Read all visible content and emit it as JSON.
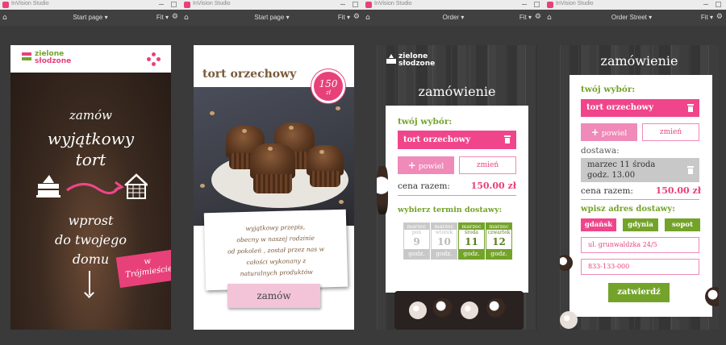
{
  "app_name": "InVision Studio",
  "panels": [
    {
      "page": "Start page",
      "zoom": "Fit"
    },
    {
      "page": "Start page",
      "zoom": "Fit"
    },
    {
      "page": "Order",
      "zoom": "Fit"
    },
    {
      "page": "Order Street",
      "zoom": "Fit"
    }
  ],
  "brand": {
    "line1": "zielone",
    "line2": "słodzone"
  },
  "icons": {
    "home": "⌂",
    "gear": "⚙",
    "caret": "▾"
  },
  "colors": {
    "pink": "#e8417a",
    "green": "#74a32a",
    "light_pink": "#f3c4d8"
  },
  "screen1": {
    "line1": "zamów",
    "line2": "wyjątkowy",
    "line3": "tort",
    "line4": "wprost",
    "line5": "do twojego",
    "line6": "domu",
    "tag_line1": "w",
    "tag_line2": "Trójmieście"
  },
  "screen2": {
    "title": "tort orzechowy",
    "price": "150",
    "currency": "zł",
    "description": [
      "wyjątkowy przepis,",
      "obecny w naszej rodzinie",
      "od pokoleń , został przez nas w",
      "całości wykonany z",
      "naturalnych produktów"
    ],
    "order_button": "zamów"
  },
  "screen3": {
    "heading": "zamówienie",
    "choice_label": "twój wybór:",
    "item": "tort orzechowy",
    "repeat_button": "powiel",
    "change_button": "zmień",
    "total_label": "cena razem:",
    "total_value": "150.00 zł",
    "delivery_label": "wybierz termin dostawy:",
    "days": [
      {
        "month": "marzec",
        "weekday": "pon",
        "day": "9",
        "label": "godz.",
        "available": false
      },
      {
        "month": "marzec",
        "weekday": "wtorek",
        "day": "10",
        "label": "godz.",
        "available": false
      },
      {
        "month": "marzec",
        "weekday": "środa",
        "day": "11",
        "label": "godz.",
        "available": true
      },
      {
        "month": "marzec",
        "weekday": "czwartek",
        "day": "12",
        "label": "godz.",
        "available": true
      }
    ]
  },
  "screen4": {
    "heading": "zamówienie",
    "choice_label": "twój wybór:",
    "item": "tort orzechowy",
    "repeat_button": "powiel",
    "change_button": "zmień",
    "delivery_label": "dostawa:",
    "delivery_line1": "marzec 11 środa",
    "delivery_line2": "godz. 13.00",
    "total_label": "cena razem:",
    "total_value": "150.00 zł",
    "address_label": "wpisz adres dostawy:",
    "cities": [
      {
        "name": "gdańsk",
        "color": "#f0458a"
      },
      {
        "name": "gdynia",
        "color": "#74a32a"
      },
      {
        "name": "sopot",
        "color": "#74a32a"
      }
    ],
    "street_value": "ul. grunwaldzka 24/5",
    "phone_value": "833-133-000",
    "confirm_button": "zatwierdź"
  }
}
